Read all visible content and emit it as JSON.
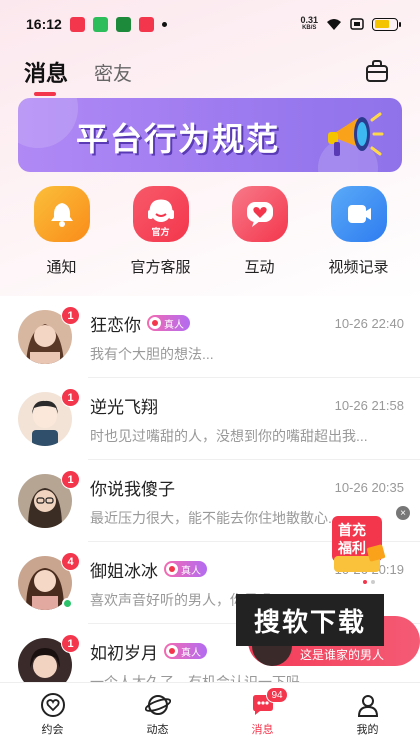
{
  "status_bar": {
    "time": "16:12",
    "net_speed_value": "0.31",
    "net_speed_unit": "KB/S",
    "battery_color": "#f4c400"
  },
  "header": {
    "tabs": [
      {
        "label": "消息",
        "active": true
      },
      {
        "label": "密友",
        "active": false
      }
    ],
    "right_icon": "bag-icon"
  },
  "banner": {
    "title": "平台行为规范",
    "icon": "megaphone-icon"
  },
  "quick_actions": [
    {
      "label": "通知",
      "icon": "bell-icon",
      "color": "#f9a21a"
    },
    {
      "label": "官方客服",
      "icon": "headset-icon",
      "color": "#f4364c",
      "sub": "官方"
    },
    {
      "label": "互动",
      "icon": "heart-chat-icon",
      "color": "#f4506a"
    },
    {
      "label": "视频记录",
      "icon": "video-icon",
      "color": "#3d8ff6"
    }
  ],
  "conversations": [
    {
      "name": "狂恋你",
      "verified": "真人",
      "time": "10-26 22:40",
      "preview": "我有个大胆的想法...",
      "unread": "1",
      "online": false,
      "avatar_color": "#c89478"
    },
    {
      "name": "逆光飞翔",
      "verified": "",
      "time": "10-26 21:58",
      "preview": "时也见过嘴甜的人，没想到你的嘴甜超出我...",
      "unread": "1",
      "online": false,
      "avatar_color": "#f0d9c8"
    },
    {
      "name": "你说我傻子",
      "verified": "",
      "time": "10-26 20:35",
      "preview": "最近压力很大，能不能去你住地散散心...",
      "unread": "1",
      "online": false,
      "avatar_color": "#a99583"
    },
    {
      "name": "御姐冰冰",
      "verified": "真人",
      "time": "10-26 20:19",
      "preview": "喜欢声音好听的男人，你是吗",
      "unread": "4",
      "online": true,
      "avatar_color": "#b99078"
    },
    {
      "name": "如初岁月",
      "verified": "真人",
      "time": "",
      "preview": "一个人太久了，有机会认识一下吗",
      "unread": "1",
      "online": false,
      "avatar_color": "#3a2a2a"
    }
  ],
  "promo": {
    "line1": "首充",
    "line2": "福利",
    "close": "×"
  },
  "download_overlay": {
    "title": "搜软下载",
    "subtitle": "这是谁家的男人"
  },
  "bottom_nav": [
    {
      "label": "约会",
      "icon": "heart-circle-icon",
      "active": false
    },
    {
      "label": "动态",
      "icon": "planet-icon",
      "active": false
    },
    {
      "label": "消息",
      "icon": "message-icon",
      "active": true,
      "badge": "94"
    },
    {
      "label": "我的",
      "icon": "person-icon",
      "active": false
    }
  ]
}
